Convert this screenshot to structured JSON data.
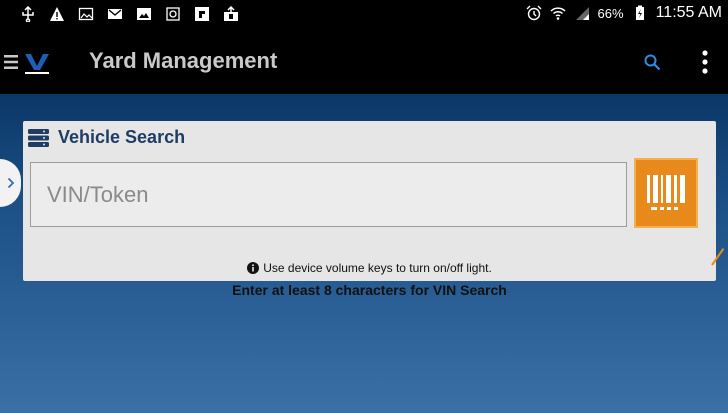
{
  "status_bar": {
    "battery": "66%",
    "time": "11:55 AM",
    "icons": [
      "usb-icon",
      "warning-icon",
      "image-icon",
      "gmail-icon",
      "photo-icon",
      "gallery-icon",
      "flipboard-icon",
      "upload-icon",
      "alarm-icon",
      "wifi-icon",
      "signal-icon",
      "battery-icon"
    ]
  },
  "app_bar": {
    "title": "Yard Management",
    "icons": [
      "menu-icon",
      "logo-icon",
      "search-icon",
      "more-vert-icon"
    ]
  },
  "vehicle_search": {
    "title": "Vehicle Search",
    "input_placeholder": "VIN/Token",
    "input_value": "",
    "info_text": "Use device volume keys to turn on/off light.",
    "hint_text": "Enter at least 8 characters for VIN Search",
    "icons": [
      "database-icon",
      "barcode-icon",
      "info-icon",
      "chevron-right-icon"
    ]
  },
  "colors": {
    "accent": "#e78a1b",
    "title_text": "#1f3d64",
    "app_bar_bg": "#000000",
    "background_top": "#0b3768",
    "background_bottom": "#3a70a6",
    "card_bg": "#e6e6e6"
  }
}
